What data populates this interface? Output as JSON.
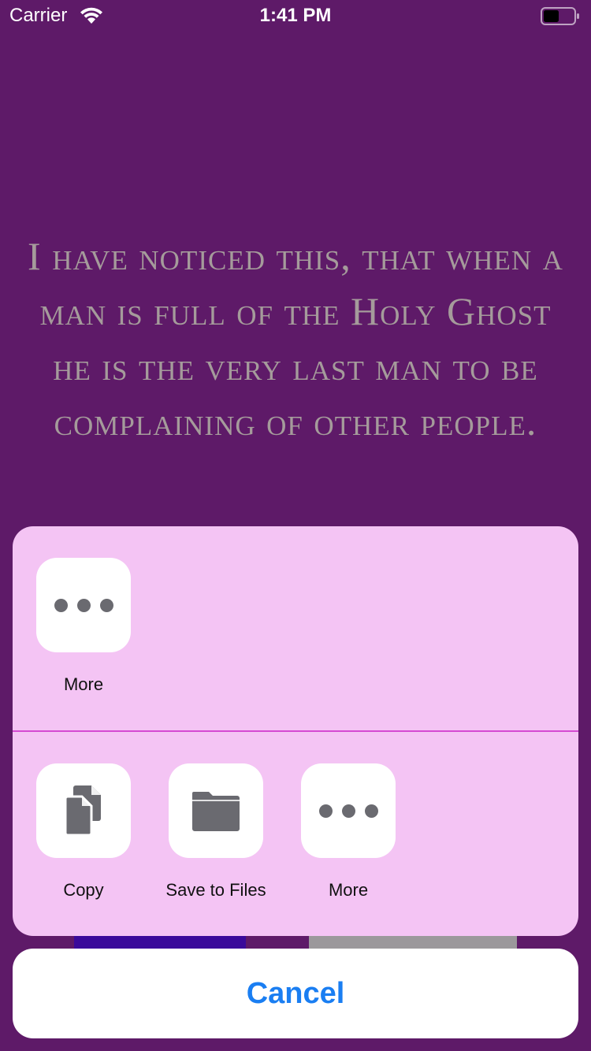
{
  "status_bar": {
    "carrier": "Carrier",
    "time": "1:41 PM"
  },
  "quote": {
    "text": "I have noticed this, that when a man is full of the Holy Ghost he is the very last man to be complaining of other people."
  },
  "share_sheet": {
    "apps": [
      {
        "label": "More",
        "icon": "more-dots-icon"
      }
    ],
    "actions": [
      {
        "label": "Copy",
        "icon": "copy-icon"
      },
      {
        "label": "Save to Files",
        "icon": "folder-icon"
      },
      {
        "label": "More",
        "icon": "more-dots-icon"
      }
    ]
  },
  "cancel_label": "Cancel",
  "colors": {
    "background": "#5e1a68",
    "sheet": "#f4c4f4",
    "divider": "#d54ad2",
    "cancel_text": "#1a7ef2",
    "icon": "#6a6a70",
    "quote_text": "#a59b9b"
  }
}
